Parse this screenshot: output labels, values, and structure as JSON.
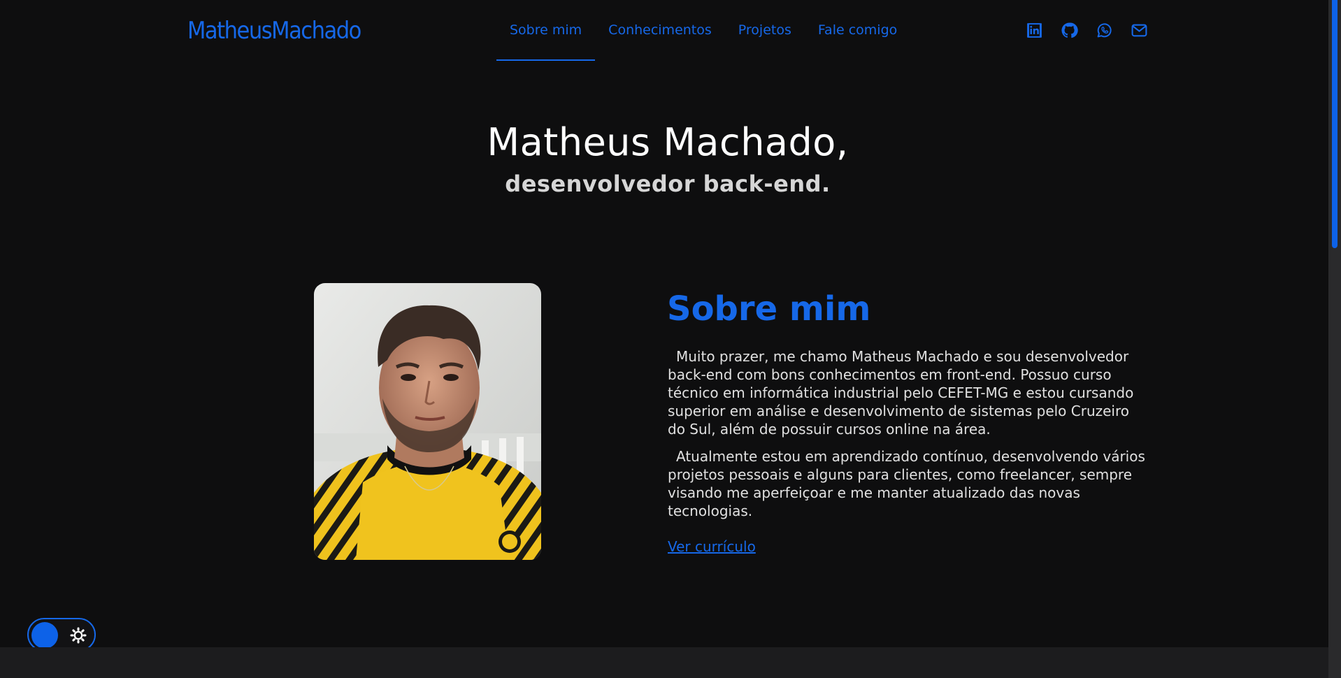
{
  "header": {
    "logo": "MatheusMachado",
    "nav": [
      {
        "label": "Sobre mim",
        "active": true
      },
      {
        "label": "Conhecimentos",
        "active": false
      },
      {
        "label": "Projetos",
        "active": false
      },
      {
        "label": "Fale comigo",
        "active": false
      }
    ],
    "socials": [
      "linkedin-icon",
      "github-icon",
      "whatsapp-icon",
      "email-icon"
    ]
  },
  "hero": {
    "title": "Matheus Machado,",
    "subtitle": "desenvolvedor back-end."
  },
  "about": {
    "title": "Sobre mim",
    "paragraphs": [
      "Muito prazer, me chamo Matheus Machado e sou desenvolvedor back-end com bons conhecimentos em front-end. Possuo curso técnico em informática industrial pelo CEFET-MG e estou cursando superior em análise e desenvolvimento de sistemas pelo Cruzeiro do Sul, além de possuir cursos online na área.",
      "Atualmente estou em aprendizado contínuo, desenvolvendo vários projetos pessoais e alguns para clientes, como freelancer, sempre visando me aperfeiçoar e me manter atualizado das novas tecnologias."
    ],
    "cv_link": "Ver currículo",
    "photo": "profile-photo"
  },
  "theme_toggle": {
    "icon": "sun-icon",
    "state": "dark"
  },
  "colors": {
    "accent": "#1668e8",
    "background": "#0e0e0f",
    "text": "#e0e0e0"
  }
}
